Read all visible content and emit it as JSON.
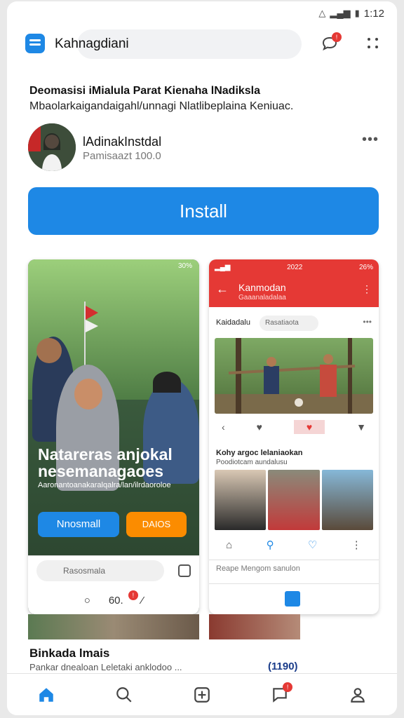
{
  "status_bar": {
    "time": "1:12",
    "icons": [
      "wifi-icon",
      "signal-icon",
      "battery-icon"
    ]
  },
  "header": {
    "app_name": "Kahnagdiani",
    "chat_badge": "!",
    "icons": [
      "app-logo-icon",
      "chat-icon",
      "more-dots-icon"
    ]
  },
  "listing": {
    "headline": "Deomasisi iMialula Parat Kienaha lNadiksla",
    "subline": "Mbaolarkaigandaigahl/unnagi Nlatlibeplaina Keniuac.",
    "app_title": "lAdinakInstdal",
    "app_meta": "Pamisaazt 100.0",
    "install_label": "Install"
  },
  "screenshot_left": {
    "status": "30%",
    "title": "Natareras anjokal nesemanagaoes",
    "subtitle": "Aaronantoanakaralqalra/lan/ilrdaoroloe",
    "btn_primary": "Nnosmall",
    "btn_secondary": "DAIOS",
    "search_placeholder": "Rasosmala",
    "action_count": "60.",
    "action_badge": "!"
  },
  "screenshot_right": {
    "status_left": "2022",
    "status_right": "26%",
    "appbar_title": "Kanmodan",
    "appbar_subtitle": "Gaaanaladalaa",
    "post_user": "Kaidadalu",
    "post_chip": "Rasatiaota",
    "section_title": "Kohy argoc lelaniaokan",
    "section_sub": "Poodiotcam aundalusu",
    "compose_text": "Reape Mengom sanulon"
  },
  "footer": {
    "title": "Binkada lmais",
    "subtitle": "Pankar dnealoan Leletaki anklodoo ...",
    "count": "(1190)"
  },
  "bottom_nav": {
    "items": [
      "home",
      "search",
      "add",
      "notifications",
      "profile"
    ],
    "notif_badge": "!"
  },
  "colors": {
    "accent": "#1e88e5",
    "red": "#e53935",
    "orange": "#fb8c00"
  }
}
